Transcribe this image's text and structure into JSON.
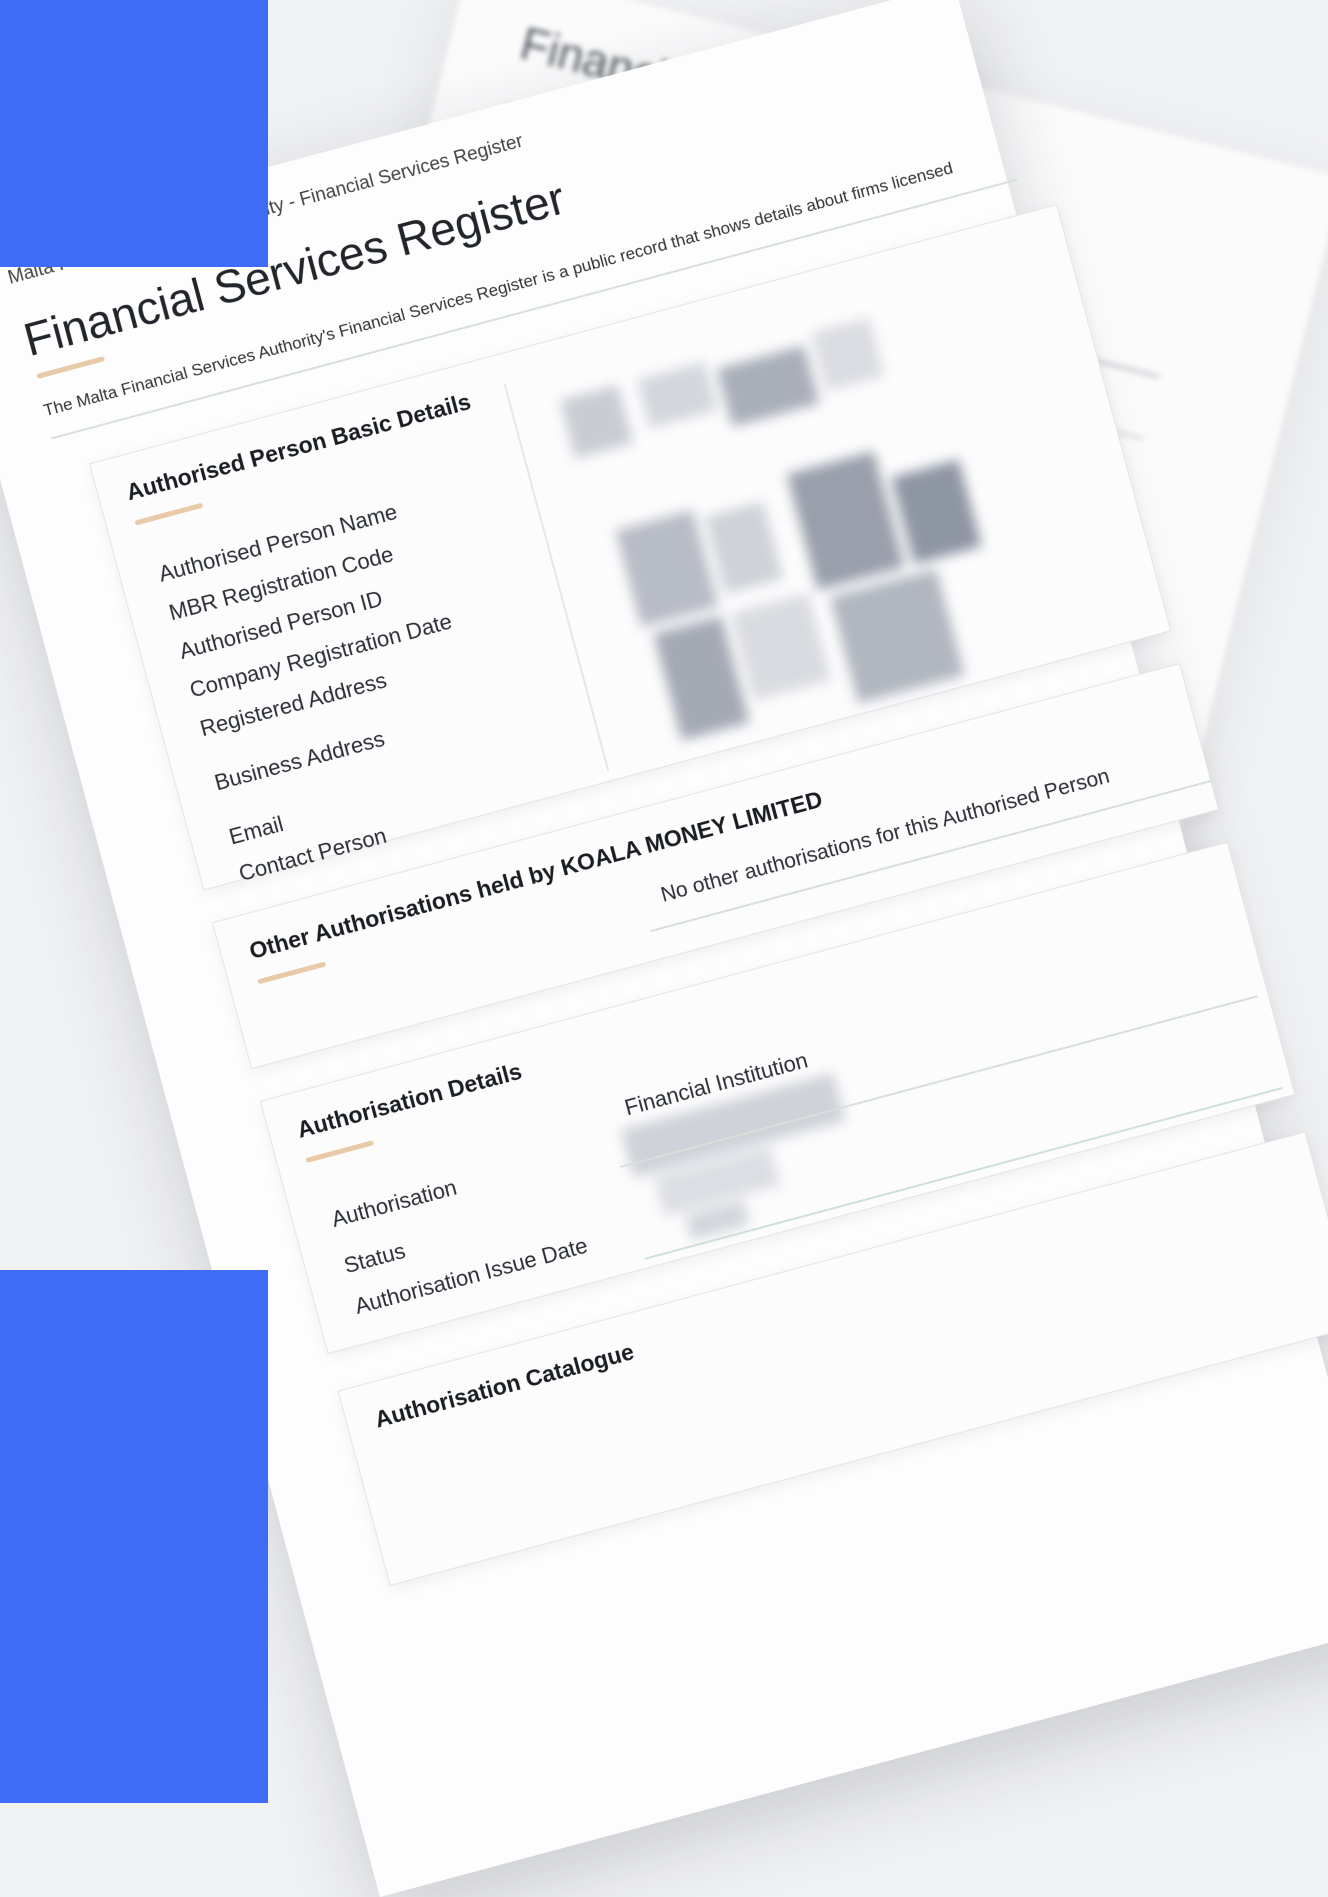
{
  "background_sheet": {
    "title": "Financial Services"
  },
  "document": {
    "breadcrumb": "Malta Financial Services Authority - Financial Services Register",
    "title": "Financial Services Register",
    "intro": "The Malta Financial Services Authority's Financial Services Register is a public record that shows details about firms licensed"
  },
  "basic_details": {
    "heading": "Authorised Person Basic Details",
    "fields": [
      "Authorised Person Name",
      "MBR Registration Code",
      "Authorised Person ID",
      "Company Registration Date",
      "Registered Address",
      "Business Address",
      "Email",
      "Contact Person"
    ]
  },
  "other_authorisations": {
    "heading": "Other Authorisations held by KOALA MONEY LIMITED",
    "message": "No other authorisations for this Authorised Person"
  },
  "authorisation_details": {
    "heading": "Authorisation Details",
    "fields": [
      "Authorisation",
      "Status",
      "Authorisation Issue Date"
    ],
    "value_category": "Financial Institution"
  },
  "authorisation_catalogue": {
    "heading": "Authorisation Catalogue"
  },
  "colors": {
    "accent_blue": "#3e6cf6",
    "underline_tan": "#e8c9a8",
    "redaction_gray": "#9aa0ab"
  }
}
